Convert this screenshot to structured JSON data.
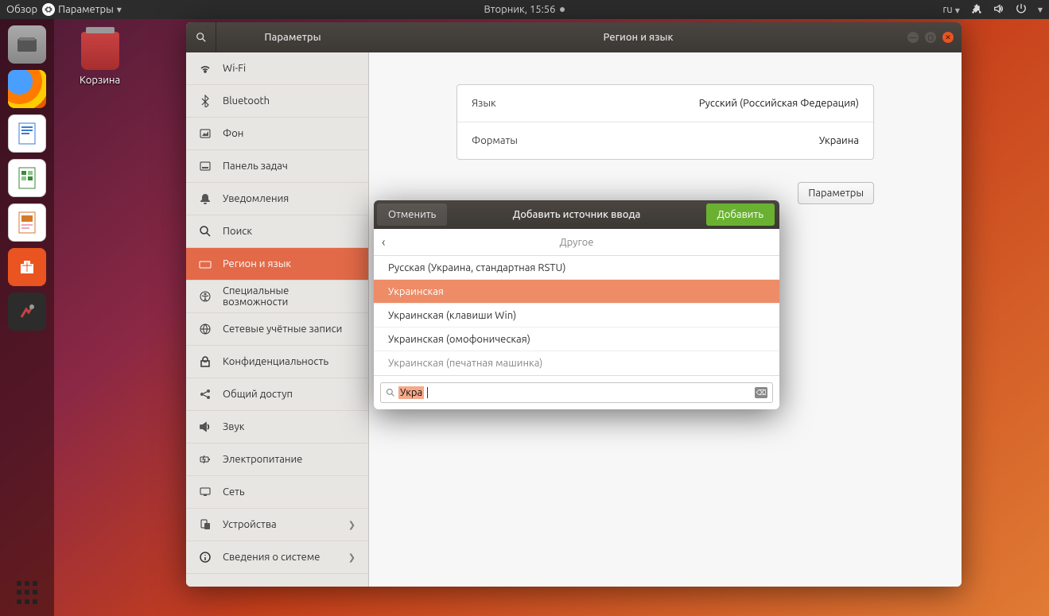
{
  "topbar": {
    "activities": "Обзор",
    "app": "Параметры",
    "clock": "Вторник, 15:56",
    "lang": "ru"
  },
  "desktop": {
    "trash": "Корзина"
  },
  "window": {
    "sidebar_title": "Параметры",
    "page_title": "Регион и язык"
  },
  "sidebar": {
    "items": [
      {
        "id": "wifi",
        "label": "Wi-Fi"
      },
      {
        "id": "bluetooth",
        "label": "Bluetooth"
      },
      {
        "id": "background",
        "label": "Фон"
      },
      {
        "id": "dock",
        "label": "Панель задач"
      },
      {
        "id": "notifications",
        "label": "Уведомления"
      },
      {
        "id": "search",
        "label": "Поиск"
      },
      {
        "id": "region",
        "label": "Регион и язык"
      },
      {
        "id": "universal",
        "label": "Специальные возможности"
      },
      {
        "id": "online",
        "label": "Сетевые учётные записи"
      },
      {
        "id": "privacy",
        "label": "Конфиденциальность"
      },
      {
        "id": "sharing",
        "label": "Общий доступ"
      },
      {
        "id": "sound",
        "label": "Звук"
      },
      {
        "id": "power",
        "label": "Электропитание"
      },
      {
        "id": "network",
        "label": "Сеть"
      },
      {
        "id": "devices",
        "label": "Устройства"
      },
      {
        "id": "about",
        "label": "Сведения о системе"
      }
    ]
  },
  "main": {
    "language_label": "Язык",
    "language_value": "Русский (Российская Федерация)",
    "formats_label": "Форматы",
    "formats_value": "Украина",
    "options_btn": "Параметры"
  },
  "modal": {
    "cancel": "Отменить",
    "title": "Добавить источник ввода",
    "add": "Добавить",
    "bread": "Другое",
    "items": [
      "Русская (Украина, стандартная RSTU)",
      "Украинская",
      "Украинская (клавиши Win)",
      "Украинская (омофоническая)",
      "Украинская (печатная машинка)"
    ],
    "search": "Укра"
  }
}
